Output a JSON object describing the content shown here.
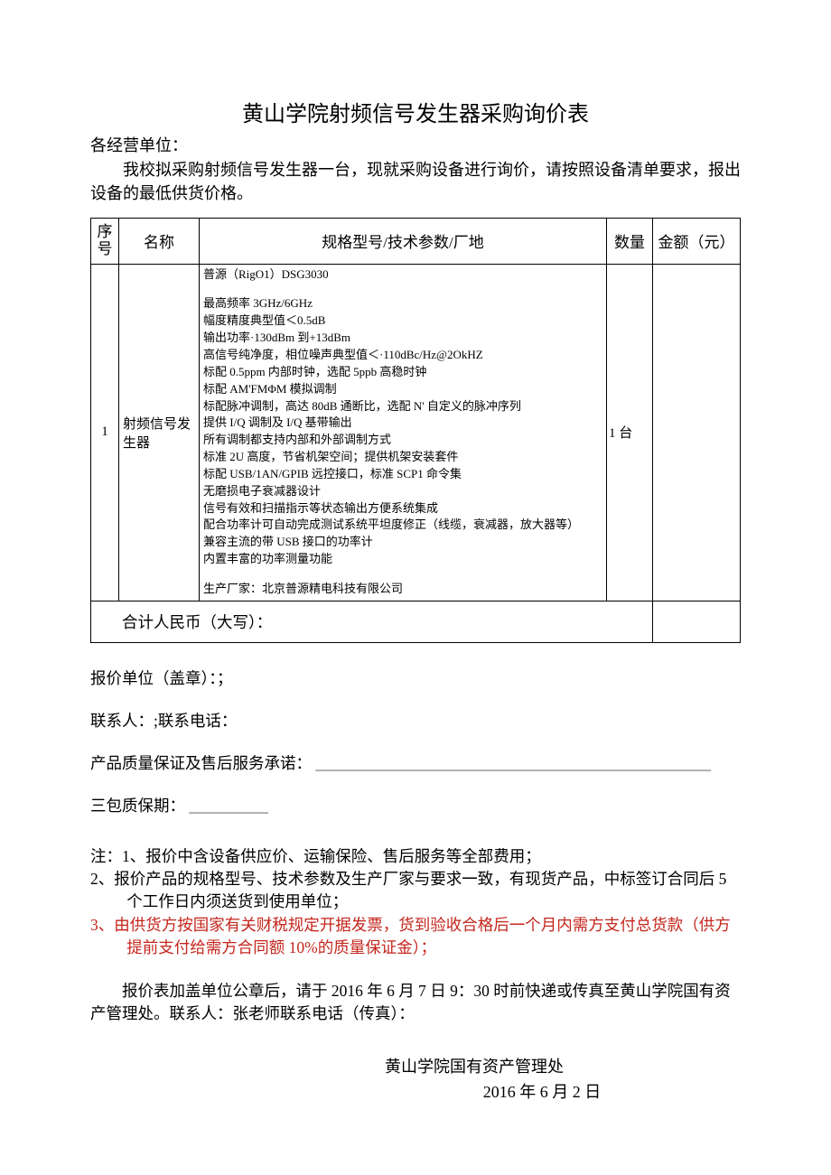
{
  "title": "黄山学院射频信号发生器采购询价表",
  "addressee": "各经营单位：",
  "intro": "我校拟采购射频信号发生器一台，现就采购设备进行询价，请按照设备清单要求，报出设备的最低供货价格。",
  "headers": {
    "seq": "序号",
    "name": "名称",
    "spec": "规格型号/技术参数/厂地",
    "qty": "数量",
    "amount": "金额（元）"
  },
  "item": {
    "seq": "1",
    "name": "射频信号发生器",
    "spec_title": "普源（RigO1）DSG3030",
    "spec_lines": [
      "最高频率 3GHz/6GHz",
      "幅度精度典型值＜0.5dB",
      "输出功率·130dBm 到+13dBm",
      "高信号纯净度，相位噪声典型值＜·110dBc/Hz@2OkHZ",
      "标配 0.5ppm 内部时钟，选配 5ppb 高稳时钟",
      "标配 AM'FMΦM 模拟调制",
      "标配脉冲调制，高达 80dB 通断比，选配 N' 自定义的脉冲序列",
      "提供 I/Q 调制及 I/Q 基带输出",
      "所有调制都支持内部和外部调制方式",
      "标准 2U 高度，节省机架空间；提供机架安装套件",
      "标配 USB/1AN/GPIB 远控接口，标准 SCP1 命令集",
      "无磨损电子衰减器设计",
      "信号有效和扫描指示等状态输出方便系统集成",
      "配合功率计可自动完成测试系统平坦度修正（线缆，衰减器，放大器等）",
      "兼容主流的带 USB 接口的功率计",
      "内置丰富的功率测量功能"
    ],
    "spec_mfr": "生产厂家：北京普源精电科技有限公司",
    "qty": "1 台"
  },
  "total_label": "合计人民币（大写）：",
  "fields": {
    "unit_label": "报价单位（盖章）：；",
    "contact_label": "联系人：;联系电话：",
    "quality_label": "产品质量保证及售后服务承诺：",
    "quality_line": "_____________________________________________________",
    "warranty_label": "三包质保期：",
    "warranty_line": "__________"
  },
  "notes": {
    "head_prefix": "注：",
    "n1": "1、报价中含设备供应价、运输保险、售后服务等全部费用；",
    "n2": "2、报价产品的规格型号、技术参数及生产厂家与要求一致，有现货产品，中标签订合同后 5 个工作日内须送货到使用单位；",
    "n3": "3、由供货方按国家有关财税规定开据发票，货到验收合格后一个月内需方支付总货款（供方提前支付给需方合同额 10%的质量保证金）；"
  },
  "delivery": "报价表加盖单位公章后，请于 2016 年 6 月 7 日 9：30 时前快递或传真至黄山学院国有资产管理处。联系人：张老师联系电话（传真）：",
  "sign": {
    "org": "黄山学院国有资产管理处",
    "date": "2016 年 6 月 2 日"
  }
}
